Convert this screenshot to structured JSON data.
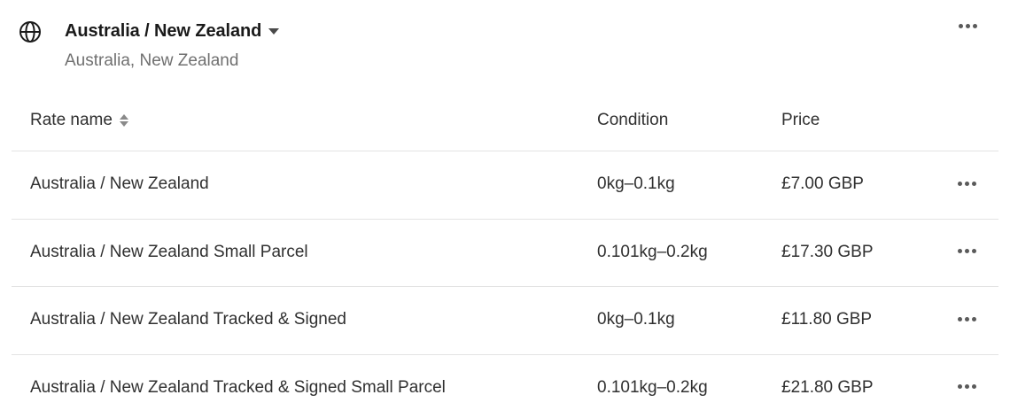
{
  "zone": {
    "title": "Australia / New Zealand",
    "subtitle": "Australia, New Zealand",
    "icon": "globe-icon"
  },
  "table": {
    "headers": {
      "rate_name": "Rate name",
      "condition": "Condition",
      "price": "Price"
    },
    "rows": [
      {
        "name": "Australia / New Zealand",
        "condition": "0kg–0.1kg",
        "price": "£7.00 GBP"
      },
      {
        "name": "Australia / New Zealand Small Parcel",
        "condition": "0.101kg–0.2kg",
        "price": "£17.30 GBP"
      },
      {
        "name": "Australia / New Zealand Tracked & Signed",
        "condition": "0kg–0.1kg",
        "price": "£11.80 GBP"
      },
      {
        "name": "Australia / New Zealand Tracked & Signed Small Parcel",
        "condition": "0.101kg–0.2kg",
        "price": "£21.80 GBP"
      }
    ]
  }
}
